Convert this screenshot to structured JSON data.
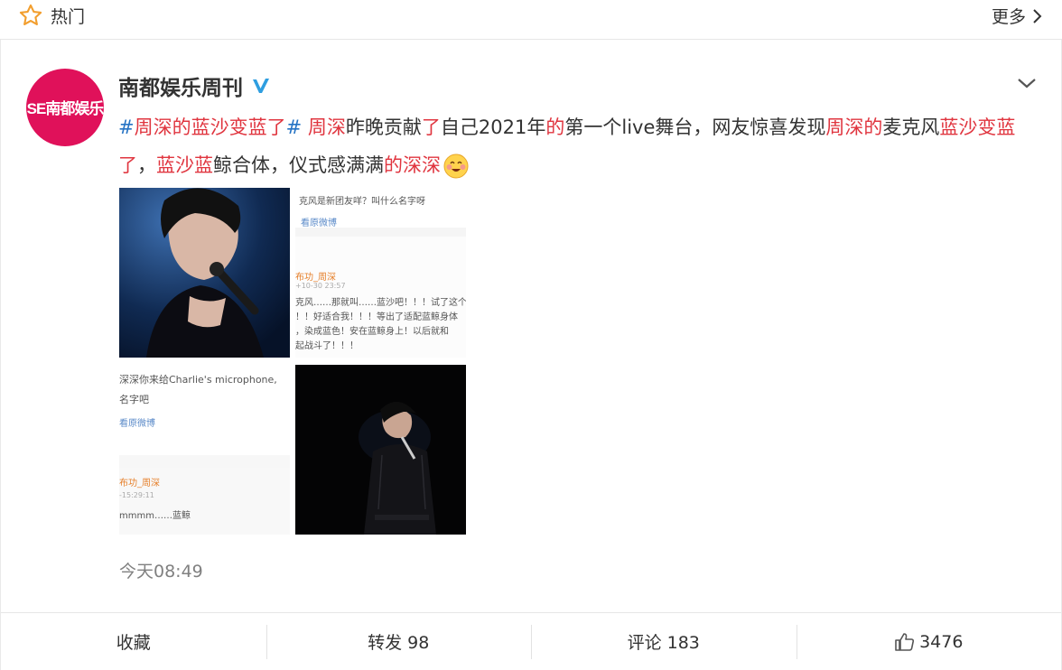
{
  "topbar": {
    "title": "热门",
    "more_label": "更多"
  },
  "post": {
    "avatar_text": "SE南都娱乐",
    "author": "南都娱乐周刊",
    "verified_icon": "verified-v-icon",
    "text_runs": [
      {
        "t": "#周深的蓝沙变蓝了#",
        "s": "topic-hl"
      },
      {
        "t": " ",
        "s": ""
      },
      {
        "t": "周深",
        "s": "hl"
      },
      {
        "t": "昨晚贡献",
        "s": ""
      },
      {
        "t": "了",
        "s": "hl"
      },
      {
        "t": "自己2021年",
        "s": ""
      },
      {
        "t": "的",
        "s": "hl"
      },
      {
        "t": "第一个live舞台，网友惊喜发现",
        "s": ""
      },
      {
        "t": "周深的",
        "s": "hl"
      },
      {
        "t": "麦克风",
        "s": ""
      },
      {
        "t": "蓝沙变蓝了",
        "s": "hl"
      },
      {
        "t": "，",
        "s": ""
      },
      {
        "t": "蓝沙蓝",
        "s": "hl"
      },
      {
        "t": "鲸合体，仪式感满满",
        "s": ""
      },
      {
        "t": "的深深",
        "s": "hl"
      }
    ],
    "emoji_icon": "smile-emoji-icon",
    "images": {
      "img2": {
        "line1": "克风是新团友咩？叫什么名字呀",
        "line2": "看原微博",
        "user": "布功_周深",
        "time": "+10-30 23:57",
        "body1": "克风……那就叫……蓝沙吧！！！试了这个",
        "body2": "！！好适合我！！！等出了适配蓝鲸身体",
        "body3": "，染成蓝色！安在蓝鲸身上！以后就和",
        "body4": "起战斗了！！！"
      },
      "img3": {
        "line1": "深深你来给Charlie's microphone,",
        "line2": "名字吧",
        "line3": "看原微博",
        "user": "布功_周深",
        "time": "-15:29:11",
        "body1": "mmmm……蓝鲸"
      }
    },
    "timestamp": "今天08:49"
  },
  "actions": {
    "favorite": "收藏",
    "repost": "转发 98",
    "comment": "评论 183",
    "like_count": "3476",
    "like_icon": "thumbs-up-icon"
  },
  "colors": {
    "highlight": "#e0353f",
    "topic": "#2573c4",
    "avatar_bg": "#e0115a",
    "star": "#f29e2e",
    "verified": "#2f9ee0"
  }
}
